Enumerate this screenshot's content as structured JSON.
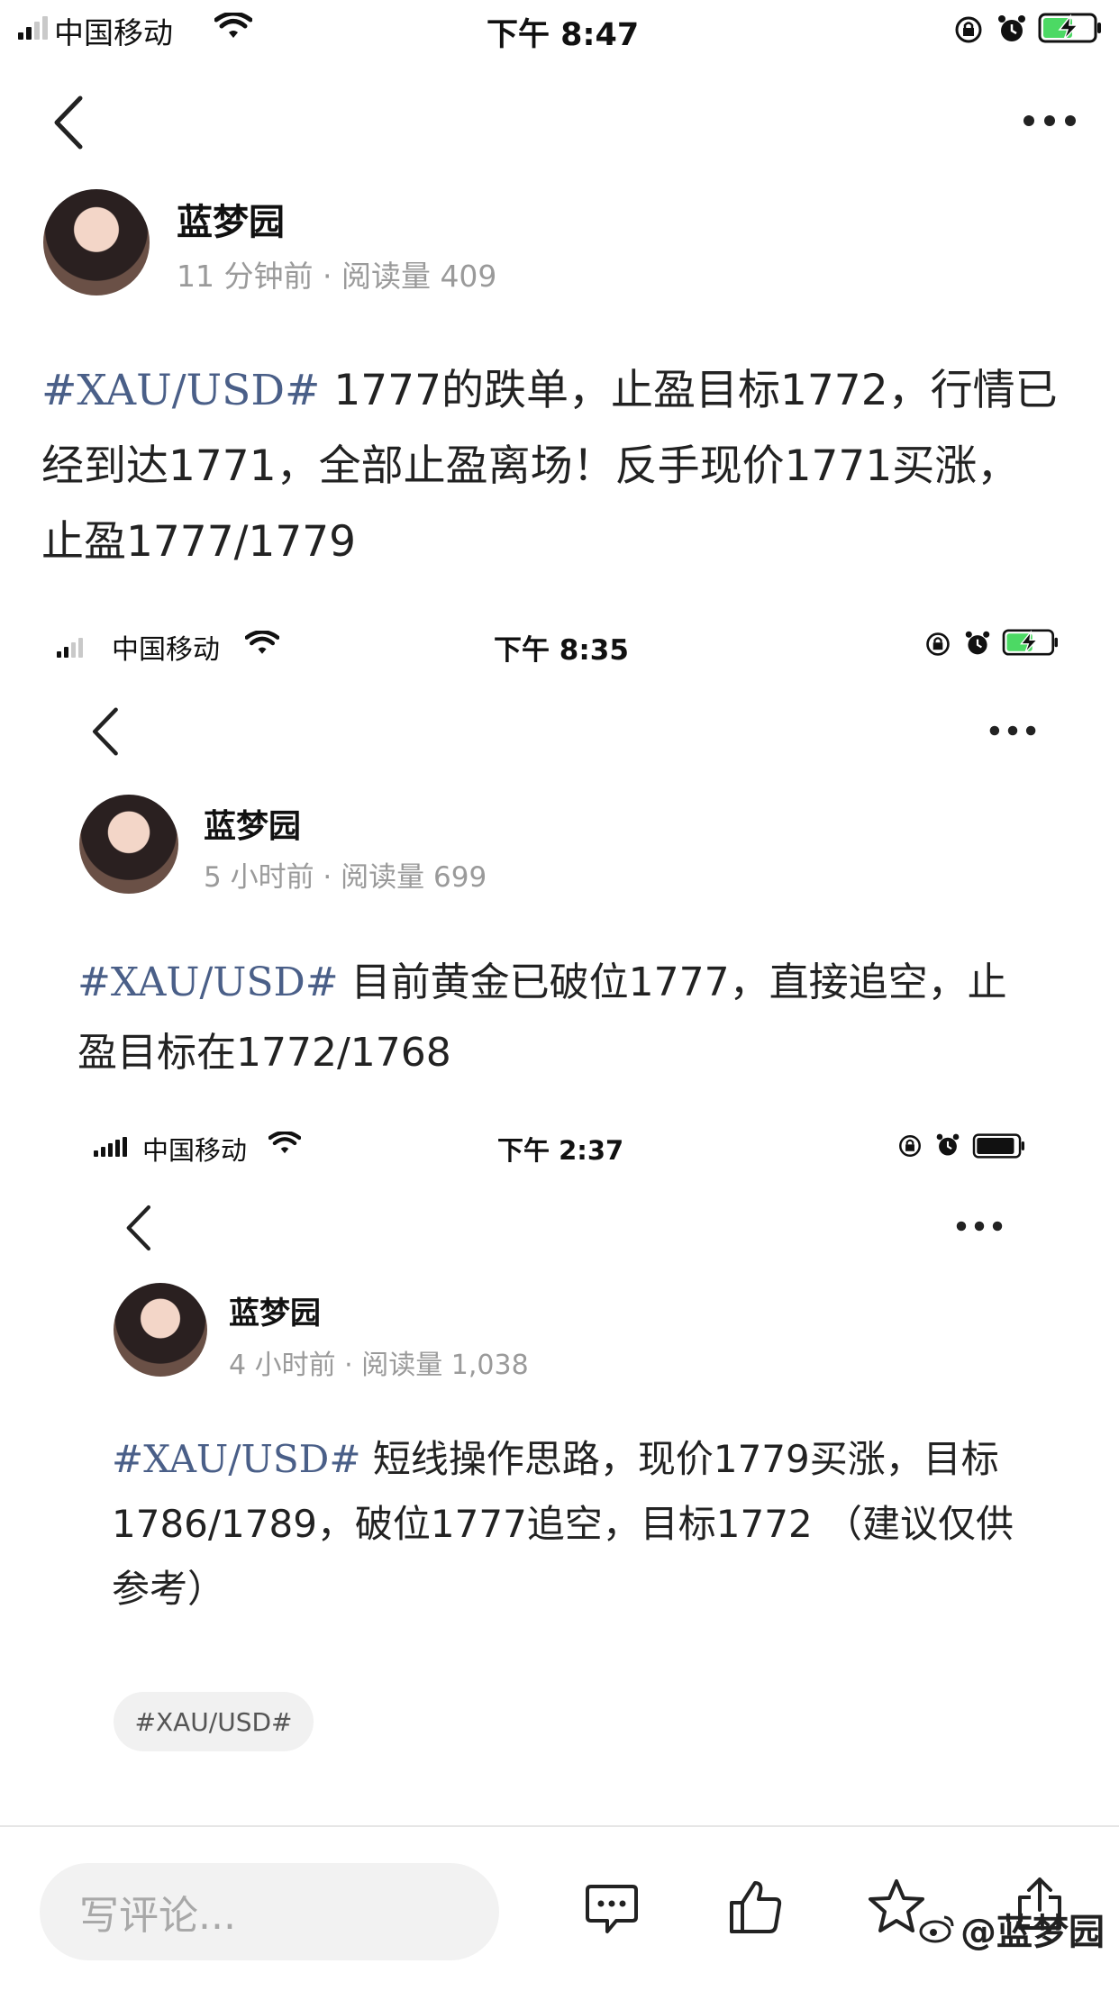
{
  "shot1": {
    "carrier": "中国移动",
    "time": "下午 8:47",
    "author": "蓝梦园",
    "meta": "11 分钟前 · 阅读量 409",
    "tag": "#XAU/USD#",
    "lines": [
      " 1777的跌单，止盈目标1772，行情已",
      "经到达1771，全部止盈离场！反手现价1771买涨，",
      "止盈1777/1779"
    ]
  },
  "shot2": {
    "carrier": "中国移动",
    "time": "下午 8:35",
    "author": "蓝梦园",
    "meta": "5 小时前 · 阅读量 699",
    "tag": "#XAU/USD#",
    "lines": [
      " 目前黄金已破位1777，直接追空，止",
      "盈目标在1772/1768"
    ]
  },
  "shot3": {
    "carrier": "中国移动",
    "time": "下午 2:37",
    "author": "蓝梦园",
    "meta": "4 小时前 · 阅读量 1,038",
    "tag": "#XAU/USD#",
    "lines": [
      " 短线操作思路，现价1779买涨，目标",
      "1786/1789，破位1777追空，目标1772 （建议仅供",
      "参考）"
    ],
    "chip": "#XAU/USD#"
  },
  "bottom": {
    "comment_placeholder": "写评论...",
    "watermark": "@蓝梦园"
  },
  "icons": [
    "back-icon",
    "more-icon",
    "wifi-icon",
    "lock-rotation-icon",
    "alarm-icon",
    "battery-icon",
    "comment-icon",
    "like-icon",
    "star-icon",
    "share-icon"
  ],
  "colors": {
    "tag": "#4a5f88",
    "battery_green": "#4cd964",
    "meta": "#9a9a9a"
  }
}
